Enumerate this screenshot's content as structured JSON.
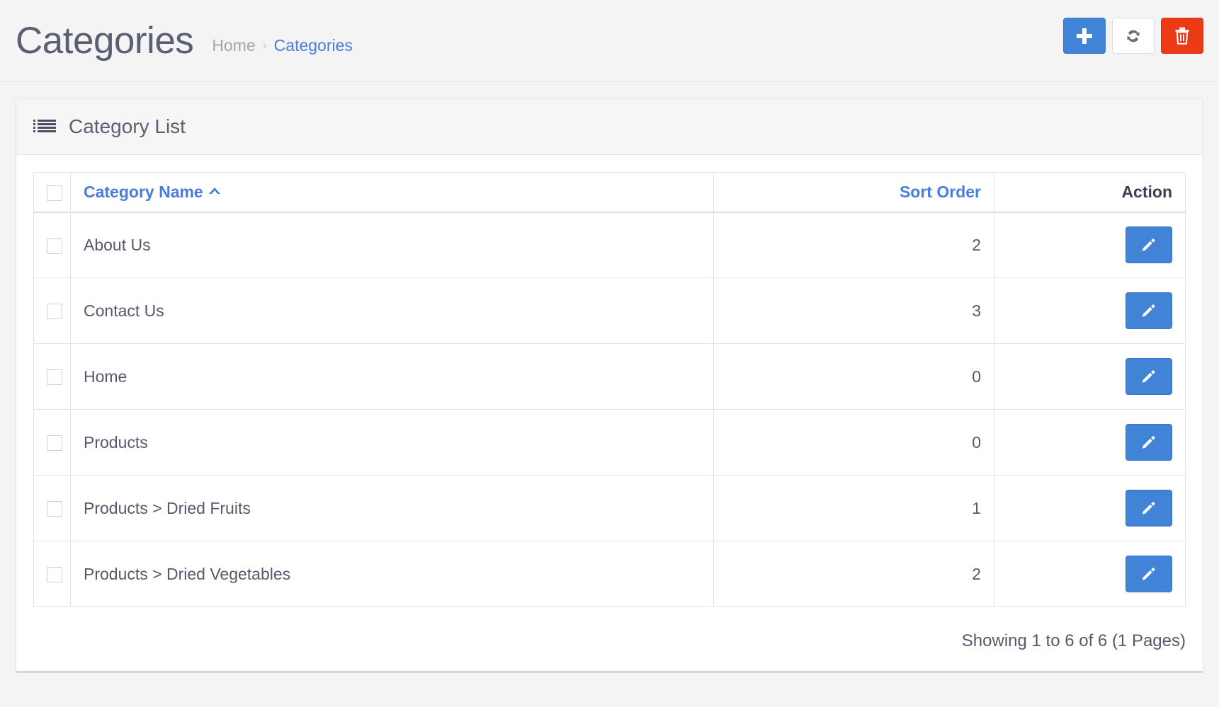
{
  "header": {
    "title": "Categories",
    "breadcrumb": {
      "home": "Home",
      "separator": "›",
      "current": "Categories"
    },
    "actions": [
      {
        "name": "add-button",
        "icon": "plus-icon",
        "label": "+",
        "color": "#4183d7"
      },
      {
        "name": "refresh-button",
        "icon": "refresh-icon",
        "label": "",
        "color": "#ffffff"
      },
      {
        "name": "delete-button",
        "icon": "trash-icon",
        "label": "",
        "color": "#ec3a16"
      }
    ]
  },
  "card": {
    "icon": "list-icon",
    "title": "Category List"
  },
  "table": {
    "columns": {
      "select_all": "",
      "name": "Category Name",
      "sort_order": "Sort Order",
      "action": "Action"
    },
    "sort": {
      "column": "Category Name",
      "direction": "ascending",
      "icon": "caret-up-icon"
    },
    "rows": [
      {
        "name": "About Us",
        "sort_order": "2",
        "edit_icon": "pencil-icon"
      },
      {
        "name": "Contact Us",
        "sort_order": "3",
        "edit_icon": "pencil-icon"
      },
      {
        "name": "Home",
        "sort_order": "0",
        "edit_icon": "pencil-icon"
      },
      {
        "name": "Products",
        "sort_order": "0",
        "edit_icon": "pencil-icon"
      },
      {
        "name": "Products  >  Dried Fruits",
        "sort_order": "1",
        "edit_icon": "pencil-icon"
      },
      {
        "name": "Products  >  Dried Vegetables",
        "sort_order": "2",
        "edit_icon": "pencil-icon"
      }
    ],
    "footer": "Showing 1 to 6 of 6 (1 Pages)"
  },
  "colors": {
    "link": "#4a7dda",
    "primary": "#4183d7",
    "danger": "#ec3a16",
    "text": "#55596b",
    "page_bg": "#f4f4f4"
  }
}
